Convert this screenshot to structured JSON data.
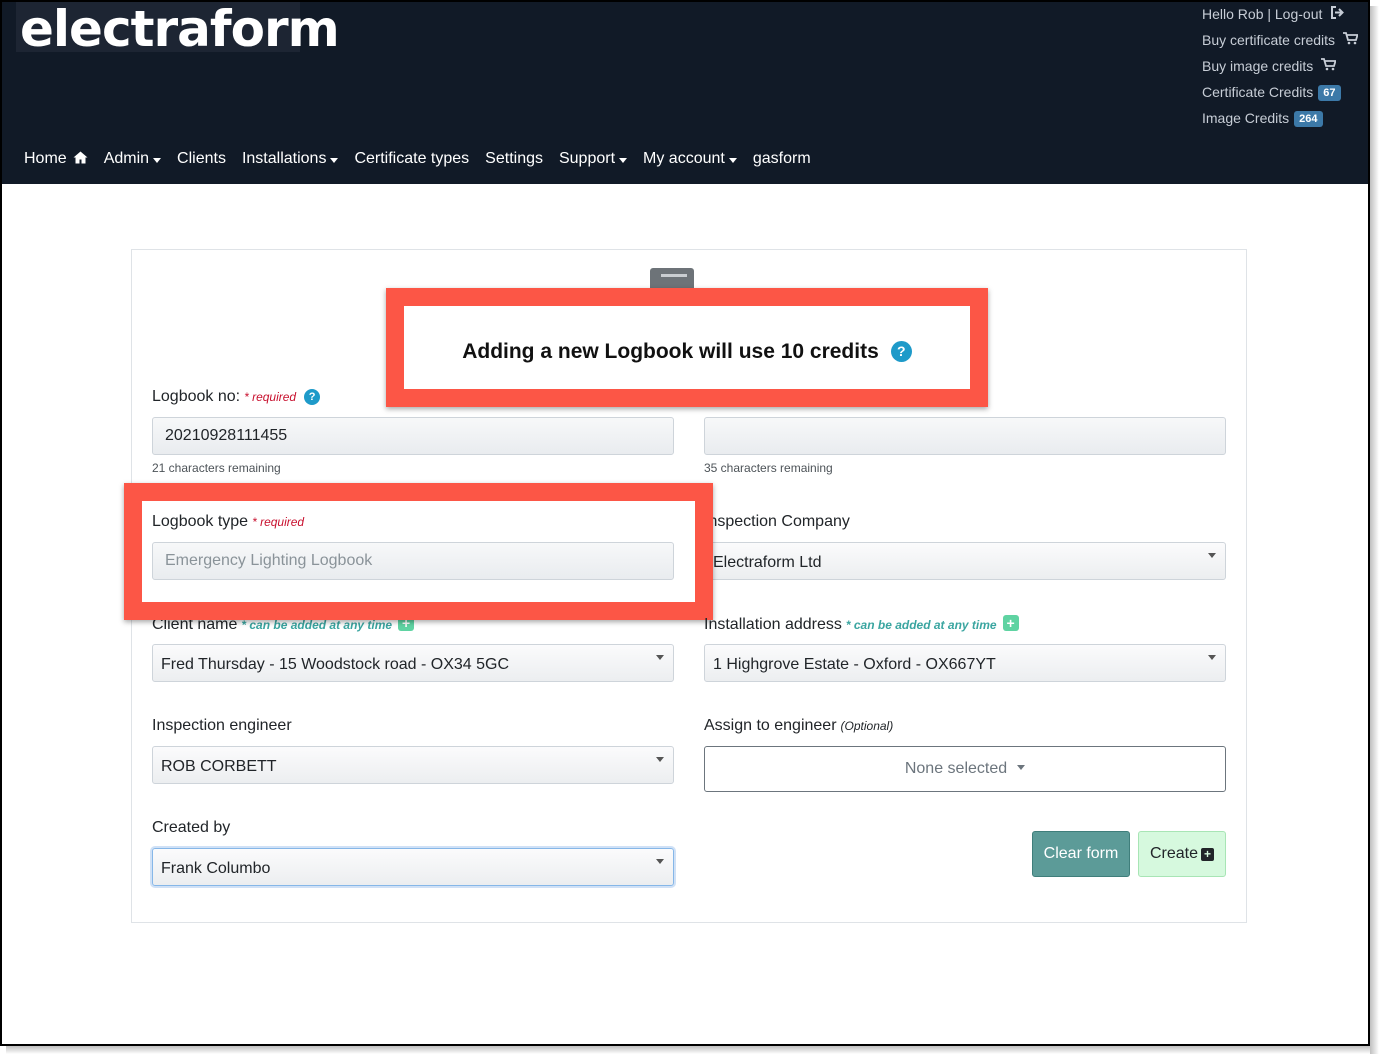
{
  "brand": {
    "logo_text": "electraform"
  },
  "user_menu": {
    "greeting": "Hello Rob | Log-out",
    "buy_certificate_credits": "Buy certificate credits",
    "buy_image_credits": "Buy image credits",
    "certificate_credits_label": "Certificate Credits",
    "certificate_credits_count": "67",
    "image_credits_label": "Image Credits",
    "image_credits_count": "264"
  },
  "nav": {
    "home": "Home",
    "admin": "Admin",
    "clients": "Clients",
    "installations": "Installations",
    "certificate_types": "Certificate types",
    "settings": "Settings",
    "support": "Support",
    "my_account": "My account",
    "gasform": "gasform"
  },
  "notice": {
    "text": "Adding a new Logbook will use 10 credits",
    "help_icon": "?"
  },
  "form": {
    "logbook_no": {
      "label": "Logbook no:",
      "required": "* required",
      "value": "20210928111455",
      "remaining": "21 characters remaining"
    },
    "second_field": {
      "value": "",
      "remaining": "35 characters remaining"
    },
    "logbook_type": {
      "label": "Logbook type",
      "required": "* required",
      "value": "Emergency Lighting Logbook"
    },
    "inspection_company": {
      "label": "Inspection Company",
      "value": "Electraform Ltd"
    },
    "client_name": {
      "label": "Client name",
      "hint": "* can be added at any time",
      "value": "Fred Thursday - 15 Woodstock road - OX34 5GC"
    },
    "installation_address": {
      "label": "Installation address",
      "hint": "* can be added at any time",
      "value": "1 Highgrove Estate - Oxford - OX667YT"
    },
    "inspection_engineer": {
      "label": "Inspection engineer",
      "value": "ROB CORBETT"
    },
    "assign_engineer": {
      "label": "Assign to engineer",
      "optional": "(Optional)",
      "value": "None selected"
    },
    "created_by": {
      "label": "Created by",
      "value": "Frank Columbo"
    },
    "clear_button": "Clear form",
    "create_button": "Create"
  },
  "colors": {
    "header_bg": "#111a27",
    "highlight_red": "#fc5646",
    "help_blue": "#1e9ac9",
    "clear_btn": "#5c9b98",
    "create_btn": "#d6f9de"
  },
  "icons": [
    "logout-icon",
    "cart-icon",
    "home-icon",
    "help-icon",
    "plus-icon",
    "print-icon"
  ]
}
